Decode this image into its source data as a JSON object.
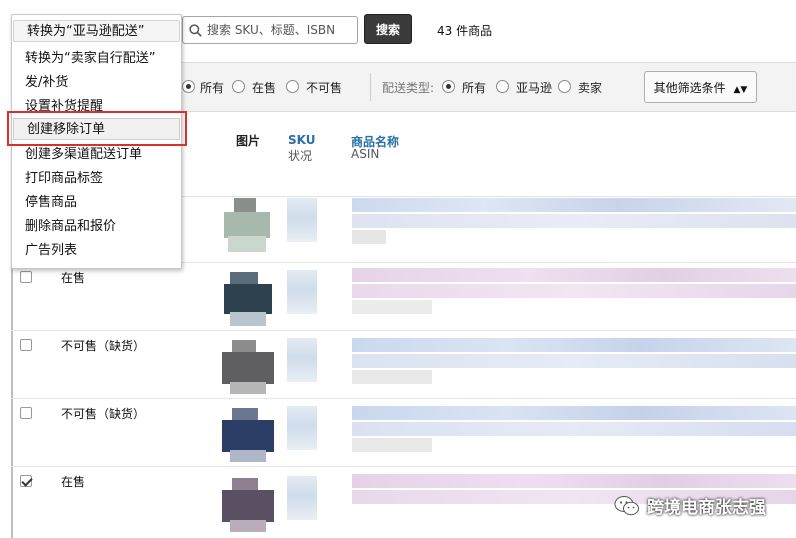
{
  "search": {
    "placeholder": "搜索 SKU、标题、ISBN",
    "button": "搜索",
    "count": "43 件商品"
  },
  "filters": {
    "status_all": "所有",
    "status_active": "在售",
    "status_inactive": "不可售",
    "fulfillment_label": "配送类型:",
    "fulfillment_all": "所有",
    "fulfillment_amazon": "亚马逊",
    "fulfillment_seller": "卖家",
    "other_button": "其他筛选条件"
  },
  "table_header": {
    "image": "图片",
    "sku": "SKU",
    "status": "状况",
    "name": "商品名称",
    "asin": "ASIN"
  },
  "menu": {
    "items": [
      "转换为“亚马逊配送”",
      "转换为“卖家自行配送”",
      "发/补货",
      "设置补货提醒",
      "创建移除订单",
      "创建多渠道配送订单",
      "打印商品标签",
      "停售商品",
      "删除商品和报价",
      "广告列表"
    ]
  },
  "rows": [
    {
      "status": "在售",
      "checked": false
    },
    {
      "status": "不可售（缺货）",
      "checked": false
    },
    {
      "status": "不可售（缺货）",
      "checked": false
    },
    {
      "status": "在售",
      "checked": true
    }
  ],
  "watermark": "跨境电商张志强",
  "colors": {
    "highlight": "#d9302b",
    "header_blue": "#2a6fa8",
    "search_button": "#3a3a3a"
  }
}
